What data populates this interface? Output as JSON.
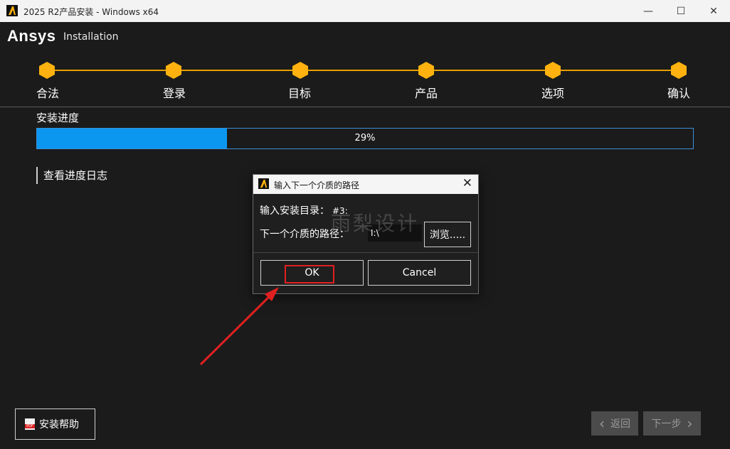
{
  "window": {
    "title": "2025 R2产品安装 - Windows x64",
    "controls": {
      "minimize": "—",
      "maximize": "☐",
      "close": "✕"
    }
  },
  "header": {
    "brand": "Ansys",
    "subtitle": "Installation"
  },
  "steps": [
    {
      "label": "合法"
    },
    {
      "label": "登录"
    },
    {
      "label": "目标"
    },
    {
      "label": "产品"
    },
    {
      "label": "选项"
    },
    {
      "label": "确认"
    }
  ],
  "progress": {
    "label": "安装进度",
    "percent_text": "29%",
    "value": 0.29
  },
  "log_link": "查看进度日志",
  "footer": {
    "help": "安装帮助",
    "back": "返回",
    "next": "下一步",
    "back_icon": "‹",
    "next_icon": "›"
  },
  "dialog": {
    "title": "输入下一个介质的路径",
    "close": "✕",
    "install_dir_label": "输入安装目录：",
    "install_dir_value": "#3:",
    "media_path_label": "下一个介质的路径：",
    "media_path_value": "I:\\",
    "browse": "浏览.....",
    "ok": "OK",
    "cancel": "Cancel"
  },
  "watermark": "雨梨设计",
  "colors": {
    "accent": "#ffb20f",
    "progress_fill": "#0b97ef",
    "annotation": "#e02020"
  }
}
